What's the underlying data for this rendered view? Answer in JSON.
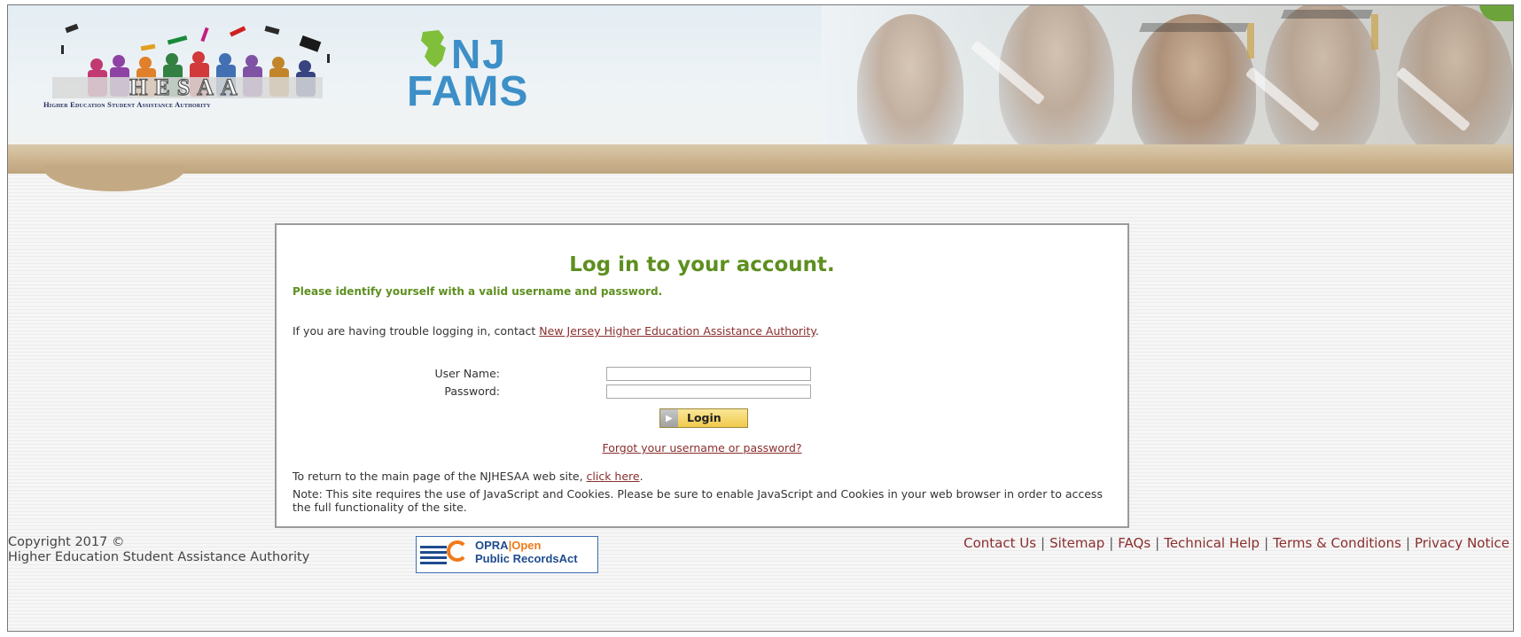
{
  "header": {
    "hesaa_logo_text": "HESAA",
    "hesaa_subtitle": "Higher Education Student Assistance Authority",
    "nj_text": "NJ",
    "fams_text": "FAMS"
  },
  "login": {
    "title": "Log in to your account.",
    "subtitle": "Please identify yourself with a valid username and password.",
    "trouble_prefix": "If you are having trouble logging in, contact ",
    "trouble_link": "New Jersey Higher Education Assistance Authority",
    "trouble_suffix": ".",
    "username_label": "User Name:",
    "username_value": "",
    "password_label": "Password:",
    "password_value": "",
    "login_button": "Login",
    "forgot_link": "Forgot your username or password?",
    "return_prefix": "To return to the main page of the NJHESAA web site, ",
    "return_link": "click here",
    "return_suffix": ".",
    "note": "Note: This site requires the use of JavaScript and Cookies. Please be sure to enable JavaScript and Cookies in your web browser in order to access the full functionality of the site."
  },
  "footer": {
    "copyright_line1": "Copyright 2017 ©",
    "copyright_line2": "Higher Education Student Assistance Authority",
    "opra_line1_a": "OPRA",
    "opra_line1_sep": "|",
    "opra_line1_b": "Open",
    "opra_line2": "Public RecordsAct",
    "links": [
      "Contact Us",
      "Sitemap",
      "FAQs",
      "Technical Help",
      "Terms & Conditions",
      "Privacy Notice"
    ]
  },
  "colors": {
    "title_green": "#5d8f1f",
    "link_red": "#8b2e2e",
    "fams_blue": "#3d8fc7",
    "opra_orange": "#f07a1a",
    "opra_blue": "#1e4b8f"
  }
}
